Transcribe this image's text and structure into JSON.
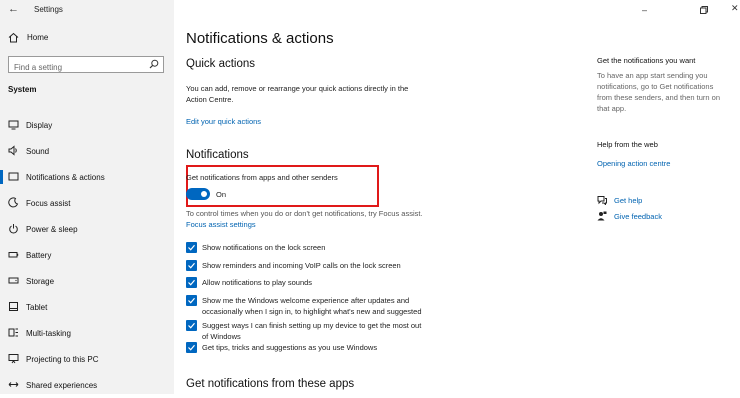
{
  "window": {
    "title": "Settings",
    "controls": [
      "minimize-icon",
      "restore-icon",
      "close-icon"
    ]
  },
  "sidebar": {
    "home_label": "Home",
    "search_placeholder": "Find a setting",
    "section_label": "System",
    "items": [
      {
        "label": "Display",
        "icon": "display-icon"
      },
      {
        "label": "Sound",
        "icon": "sound-icon"
      },
      {
        "label": "Notifications & actions",
        "icon": "notifications-icon",
        "active": true
      },
      {
        "label": "Focus assist",
        "icon": "focus-assist-icon"
      },
      {
        "label": "Power & sleep",
        "icon": "power-icon"
      },
      {
        "label": "Battery",
        "icon": "battery-icon"
      },
      {
        "label": "Storage",
        "icon": "storage-icon"
      },
      {
        "label": "Tablet",
        "icon": "tablet-icon"
      },
      {
        "label": "Multi-tasking",
        "icon": "multitasking-icon"
      },
      {
        "label": "Projecting to this PC",
        "icon": "projecting-icon"
      },
      {
        "label": "Shared experiences",
        "icon": "shared-experiences-icon"
      }
    ]
  },
  "main": {
    "page_title": "Notifications & actions",
    "quick_actions": {
      "heading": "Quick actions",
      "description_line1": "You can add, remove or rearrange your quick actions directly in the",
      "description_line2": "Action Centre.",
      "edit_link": "Edit your quick actions"
    },
    "notifications": {
      "heading": "Notifications",
      "toggle_label": "Get notifications from apps and other senders",
      "toggle_state": "On",
      "toggle_on": true,
      "focus_text": "To control times when you do or don't get notifications, try Focus assist.",
      "focus_link": "Focus assist settings",
      "checkboxes": [
        {
          "label": "Show notifications on the lock screen",
          "checked": true
        },
        {
          "label": "Show reminders and incoming VoIP calls on the lock screen",
          "checked": true
        },
        {
          "label": "Allow notifications to play sounds",
          "checked": true
        },
        {
          "label_line1": "Show me the Windows welcome experience after updates and",
          "label_line2": "occasionally when I sign in, to highlight what's new and suggested",
          "checked": true
        },
        {
          "label_line1": "Suggest ways I can finish setting up my device to get the most out",
          "label_line2": "of Windows",
          "checked": true
        },
        {
          "label": "Get tips, tricks and suggestions as you use Windows",
          "checked": true
        }
      ]
    },
    "senders_heading": "Get notifications from these apps"
  },
  "side_panel": {
    "get_notif_heading": "Get the notifications you want",
    "get_notif_text": [
      "To have an app start sending you",
      "notifications, go to Get notifications",
      "from these senders, and then turn on",
      "that app."
    ],
    "help_heading": "Help from the web",
    "help_link": "Opening action centre",
    "get_help": "Get help",
    "give_feedback": "Give feedback"
  },
  "colors": {
    "accent": "#0067c0",
    "link": "#0063b1",
    "highlight": "#e01919",
    "sidebar_bg": "#f2f2f2"
  }
}
